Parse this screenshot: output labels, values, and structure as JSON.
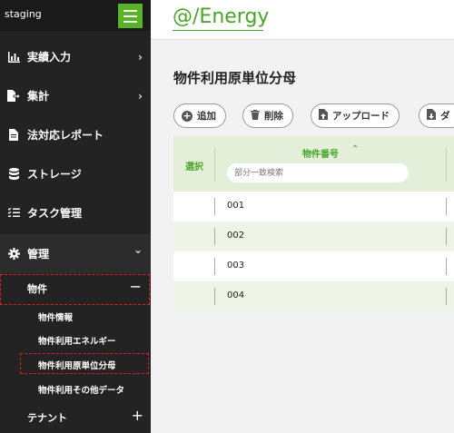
{
  "env": {
    "label": "staging"
  },
  "logo": {
    "text": "@/Energy"
  },
  "sidebar": {
    "items": [
      {
        "label": "実績入力",
        "icon": "bar-chart-icon",
        "chevron": "›"
      },
      {
        "label": "集計",
        "icon": "file-export-icon",
        "chevron": "›"
      },
      {
        "label": "法対応レポート",
        "icon": "document-icon",
        "chevron": ""
      },
      {
        "label": "ストレージ",
        "icon": "database-icon",
        "chevron": ""
      },
      {
        "label": "タスク管理",
        "icon": "task-list-icon",
        "chevron": ""
      },
      {
        "label": "管理",
        "icon": "gear-icon",
        "chevron": "⌄"
      }
    ],
    "property": {
      "label": "物件",
      "toggle": "−"
    },
    "property_sub": [
      {
        "label": "物件情報"
      },
      {
        "label": "物件利用エネルギー"
      },
      {
        "label": "物件利用原単位分母"
      },
      {
        "label": "物件利用その他データ"
      }
    ],
    "tenant": {
      "label": "テナント",
      "toggle": "+"
    }
  },
  "main": {
    "title": "物件利用原単位分母",
    "toolbar": {
      "add": "追加",
      "delete": "削除",
      "upload": "アップロード",
      "download": "ダ"
    },
    "table": {
      "col_select": "選択",
      "col_number": "物件番号",
      "sort_indicator": "⌃",
      "filter_placeholder": "部分一致検索",
      "rows": [
        "001",
        "002",
        "003",
        "004"
      ]
    }
  }
}
